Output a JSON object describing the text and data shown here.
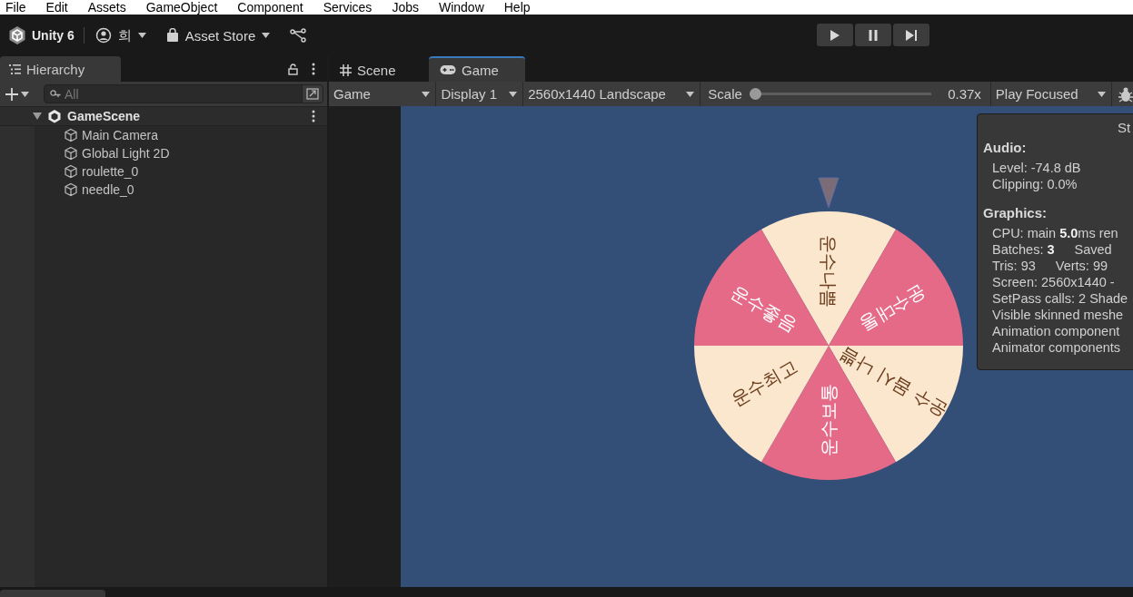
{
  "menu": [
    "File",
    "Edit",
    "Assets",
    "GameObject",
    "Component",
    "Services",
    "Jobs",
    "Window",
    "Help"
  ],
  "toolbar": {
    "product": "Unity 6",
    "account": "희",
    "store": "Asset Store"
  },
  "hierarchy": {
    "tab": "Hierarchy",
    "search": {
      "placeholder": "All"
    },
    "tree": [
      {
        "label": "GameScene",
        "expanded": true,
        "children": [
          {
            "label": "Main Camera"
          },
          {
            "label": "Global Light 2D"
          },
          {
            "label": "roulette_0"
          },
          {
            "label": "needle_0"
          }
        ]
      }
    ]
  },
  "tabs": [
    {
      "label": "Scene",
      "kind": "scene",
      "selected": false
    },
    {
      "label": "Game",
      "kind": "game",
      "selected": true
    }
  ],
  "game_toolbar": {
    "mode": "Game",
    "display": "Display 1",
    "resolution": "2560x1440 Landscape",
    "scale": {
      "label": "Scale",
      "level": 0,
      "reading": "0.37x"
    },
    "play_mode": "Play Focused"
  },
  "wheel": {
    "segments": [
      {
        "label": "운수나쁨",
        "color": "#fae7ce"
      },
      {
        "label": "운수대통",
        "color": "#e56a88"
      },
      {
        "label": "운수 몹시 나쁨",
        "color": "#fae7ce"
      },
      {
        "label": "운수보통",
        "color": "#e56a88"
      },
      {
        "label": "운수최고",
        "color": "#fae7ce"
      },
      {
        "label": "운수좋음",
        "color": "#e56a88"
      }
    ]
  },
  "stats": {
    "title": "St",
    "sections": [
      {
        "heading": "Audio:",
        "lines": [
          [
            "Level: -74.8 dB"
          ],
          [
            "Clipping: 0.0%"
          ]
        ]
      },
      {
        "heading": "Graphics:",
        "lines": [
          [
            "CPU: main **5.0**ms  ren"
          ],
          [
            "Batches: **3**",
            "Saved"
          ],
          [
            "Tris: 93",
            "Verts: 99"
          ],
          [
            "Screen: 2560x1440 -"
          ],
          [
            "SetPass calls: 2 Shade"
          ],
          [
            "Visible skinned meshe"
          ],
          [
            "Animation component"
          ],
          [
            "Animator components"
          ]
        ]
      }
    ]
  }
}
